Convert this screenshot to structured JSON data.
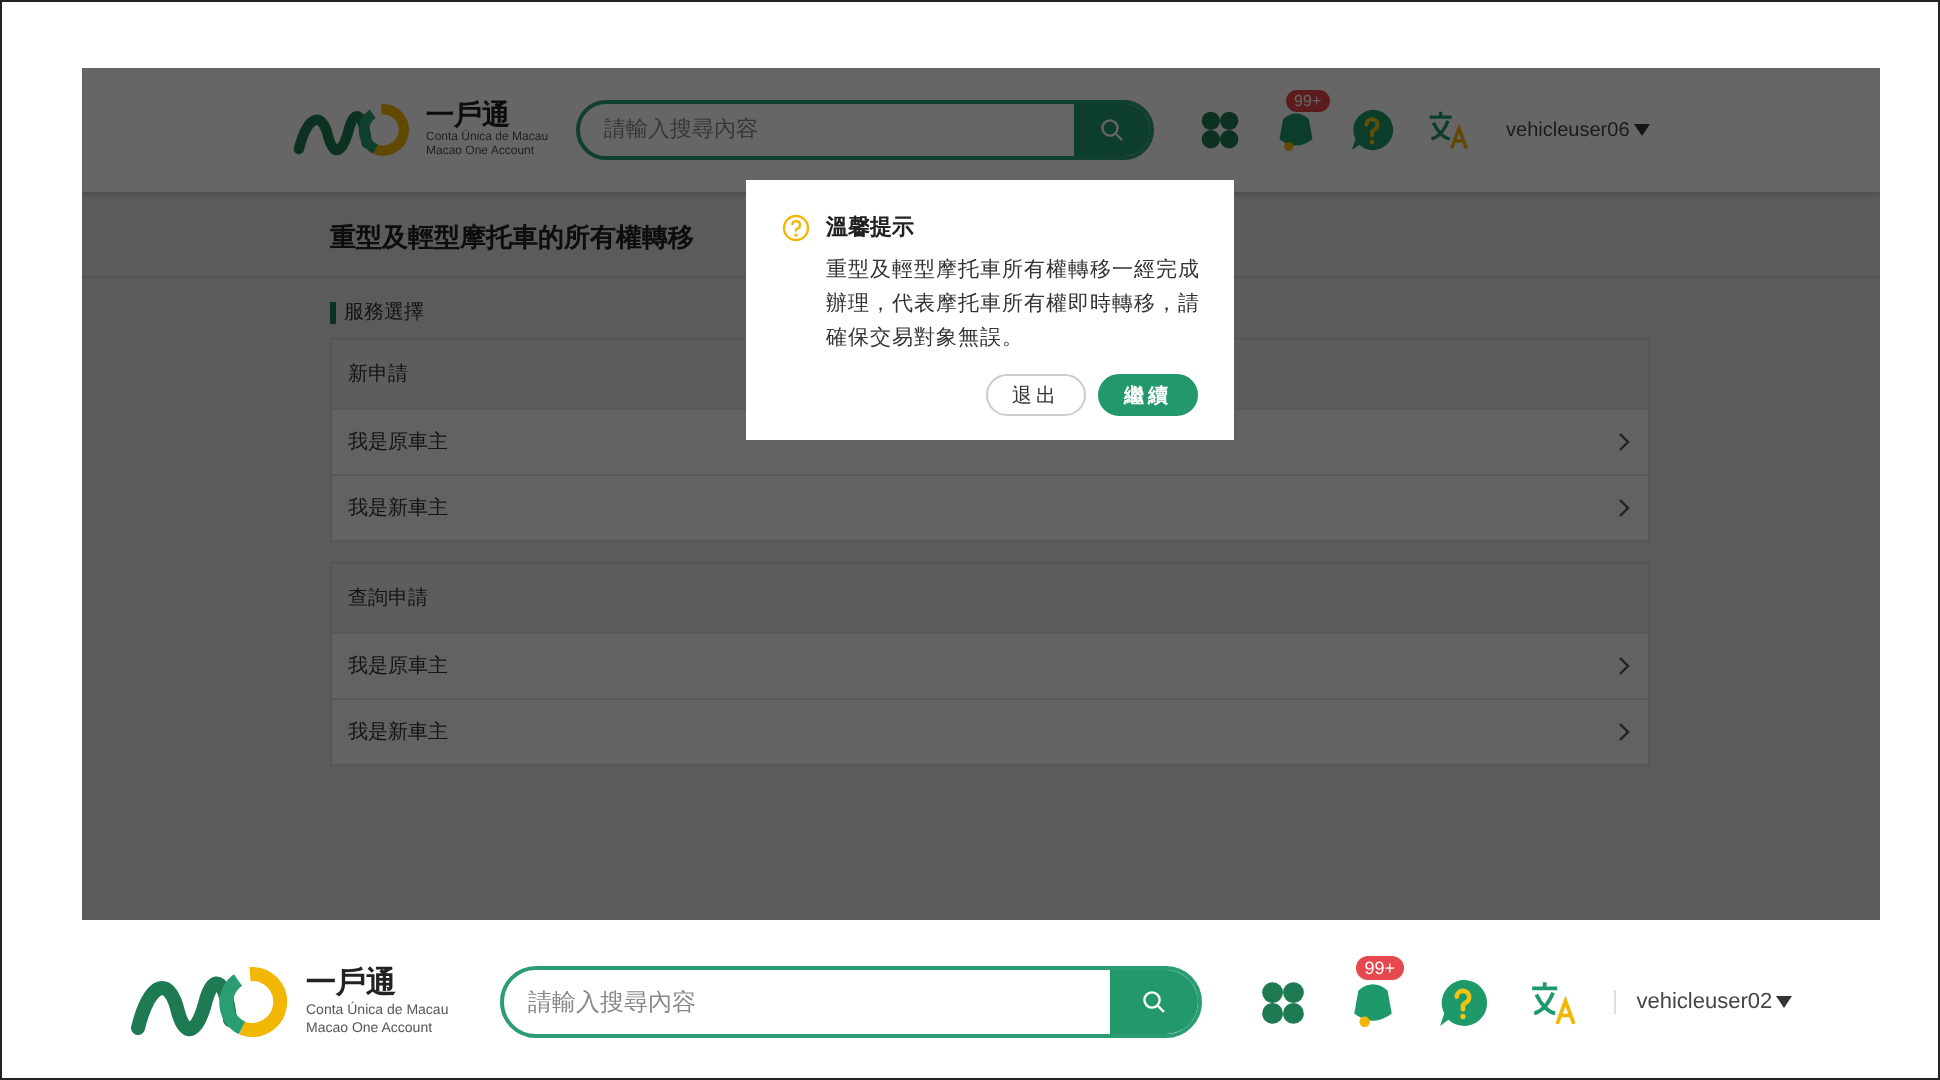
{
  "top_screen": {
    "header": {
      "logo_title": "一戶通",
      "logo_lines": [
        "Conta Única de Macau",
        "Macao One Account"
      ],
      "search": {
        "placeholder": "請輸入搜尋內容"
      },
      "notification_badge": "99+",
      "user": "vehicleuser06"
    },
    "page": {
      "title": "重型及輕型摩托車的所有權轉移",
      "section_label": "服務選擇",
      "groups": [
        {
          "heading": "新申請",
          "items": [
            {
              "label": "我是原車主"
            },
            {
              "label": "我是新車主"
            }
          ]
        },
        {
          "heading": "查詢申請",
          "items": [
            {
              "label": "我是原車主"
            },
            {
              "label": "我是新車主"
            }
          ]
        }
      ]
    },
    "dialog": {
      "title": "溫馨提示",
      "message": "重型及輕型摩托車所有權轉移一經完成辦理，代表摩托車所有權即時轉移，請確保交易對象無誤。",
      "buttons": [
        {
          "label": "退出",
          "kind": "secondary"
        },
        {
          "label": "繼續",
          "kind": "primary"
        }
      ]
    }
  },
  "bottom_header": {
    "logo_title": "一戶通",
    "logo_lines": [
      "Conta Única de Macau",
      "Macao One Account"
    ],
    "search": {
      "placeholder": "請輸入搜尋內容"
    },
    "notification_badge": "99+",
    "user": "vehicleuser02"
  }
}
